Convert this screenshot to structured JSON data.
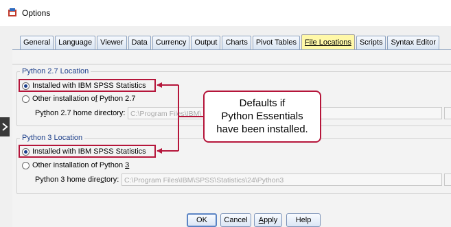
{
  "window": {
    "title": "Options",
    "icon": "spss-options-icon"
  },
  "tabs": [
    {
      "label": "General"
    },
    {
      "label": "Language"
    },
    {
      "label": "Viewer"
    },
    {
      "label": "Data"
    },
    {
      "label": "Currency"
    },
    {
      "label": "Output"
    },
    {
      "label": "Charts"
    },
    {
      "label": "Pivot Tables"
    },
    {
      "label": "File Locations",
      "active": true
    },
    {
      "label": "Scripts"
    },
    {
      "label": "Syntax Editor"
    }
  ],
  "python27": {
    "group_label": "Python 2.7 Location",
    "option_installed": "Installed with IBM SPSS Statistics",
    "option_installed_selected": true,
    "option_other_prefix": "Other installation o",
    "option_other_accel": "f",
    "option_other_suffix": " Python 2.7",
    "home_label_prefix": "Py",
    "home_label_accel": "t",
    "home_label_suffix": "hon 2.7 home directory:",
    "home_value": "C:\\Program Files\\IBM\\"
  },
  "python3": {
    "group_label": "Python 3 Location",
    "option_installed": "Installed with IBM SPSS Statistics",
    "option_installed_selected": true,
    "option_other_prefix": "Other installation of Python ",
    "option_other_accel": "3",
    "home_label_prefix": "Python 3 home dire",
    "home_label_accel": "c",
    "home_label_suffix": "tory:",
    "home_value": "C:\\Program Files\\IBM\\SPSS\\Statistics\\24\\Python3"
  },
  "callout": {
    "line1": "Defaults if",
    "line2": "Python Essentials",
    "line3": "have been installed."
  },
  "buttons": {
    "ok": "OK",
    "cancel": "Cancel",
    "apply_accel": "A",
    "apply_rest": "pply",
    "help": "Help"
  },
  "colors": {
    "annotation": "#b5153a",
    "selected_tab": "#fff8a8",
    "group_label": "#1d3f8a"
  }
}
